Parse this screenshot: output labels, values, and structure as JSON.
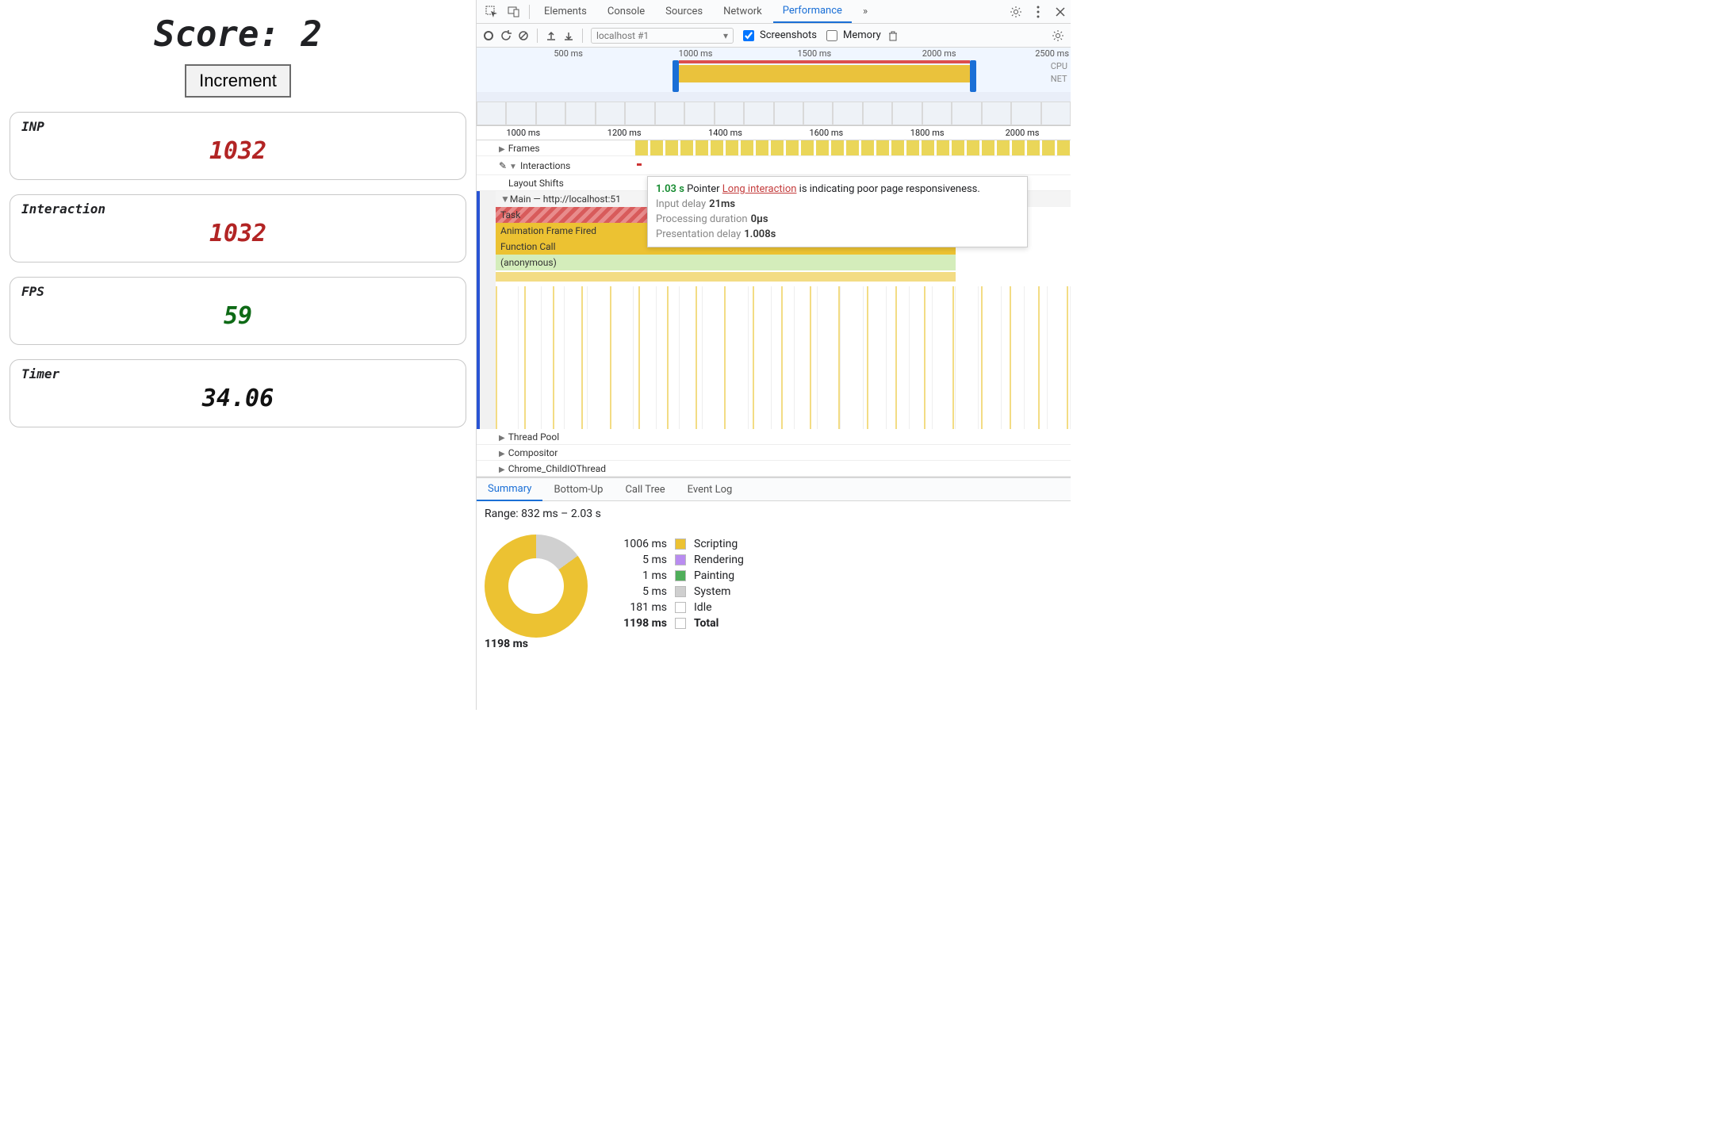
{
  "app": {
    "score_label": "Score: ",
    "score_value": "2",
    "increment_label": "Increment",
    "cards": {
      "inp": {
        "label": "INP",
        "value": "1032",
        "color": "red"
      },
      "inter": {
        "label": "Interaction",
        "value": "1032",
        "color": "red"
      },
      "fps": {
        "label": "FPS",
        "value": "59",
        "color": "green"
      },
      "timer": {
        "label": "Timer",
        "value": "34.06",
        "color": "black"
      }
    }
  },
  "devtools": {
    "tabs": [
      "Elements",
      "Console",
      "Sources",
      "Network",
      "Performance"
    ],
    "active_tab": "Performance",
    "more_tabs_icon": "»",
    "toolbar": {
      "target": "localhost #1",
      "screenshots_label": "Screenshots",
      "screenshots_checked": true,
      "memory_label": "Memory",
      "memory_checked": false
    },
    "overview_ticks": [
      "500 ms",
      "1000 ms",
      "1500 ms",
      "2000 ms",
      "2500 ms"
    ],
    "overview_labels": {
      "cpu": "CPU",
      "net": "NET"
    },
    "flame_ticks": [
      "1000 ms",
      "1200 ms",
      "1400 ms",
      "1600 ms",
      "1800 ms",
      "2000 ms"
    ],
    "tracks": {
      "frames": "Frames",
      "interactions": "Interactions",
      "layout_shifts": "Layout Shifts",
      "main": "Main — http://localhost:51",
      "task": "Task",
      "af": "Animation Frame Fired",
      "fc": "Function Call",
      "anon": "(anonymous)",
      "thread_pool": "Thread Pool",
      "compositor": "Compositor",
      "child_io": "Chrome_ChildIOThread"
    },
    "tooltip": {
      "duration": "1.03 s",
      "kind": "Pointer",
      "link": "Long interaction",
      "rest": "is indicating poor page responsiveness.",
      "rows": [
        {
          "k": "Input delay",
          "v": "21ms"
        },
        {
          "k": "Processing duration",
          "v": "0µs"
        },
        {
          "k": "Presentation delay",
          "v": "1.008s"
        }
      ]
    },
    "summary": {
      "tabs": [
        "Summary",
        "Bottom-Up",
        "Call Tree",
        "Event Log"
      ],
      "active": "Summary",
      "range": "Range: 832 ms – 2.03 s",
      "donut_center": "1198 ms",
      "legend": [
        {
          "ms": "1006 ms",
          "name": "Scripting",
          "c": "#ecc232"
        },
        {
          "ms": "5 ms",
          "name": "Rendering",
          "c": "#b98cf0"
        },
        {
          "ms": "1 ms",
          "name": "Painting",
          "c": "#4fae5a"
        },
        {
          "ms": "5 ms",
          "name": "System",
          "c": "#cfcfcf"
        },
        {
          "ms": "181 ms",
          "name": "Idle",
          "c": "#ffffff"
        },
        {
          "ms": "1198 ms",
          "name": "Total",
          "c": "#ffffff",
          "total": true
        }
      ]
    }
  },
  "chart_data": {
    "type": "pie",
    "title": "Time breakdown",
    "series": [
      {
        "name": "Scripting",
        "value": 1006,
        "unit": "ms"
      },
      {
        "name": "Rendering",
        "value": 5,
        "unit": "ms"
      },
      {
        "name": "Painting",
        "value": 1,
        "unit": "ms"
      },
      {
        "name": "System",
        "value": 5,
        "unit": "ms"
      },
      {
        "name": "Idle",
        "value": 181,
        "unit": "ms"
      }
    ],
    "total": {
      "value": 1198,
      "unit": "ms"
    }
  }
}
